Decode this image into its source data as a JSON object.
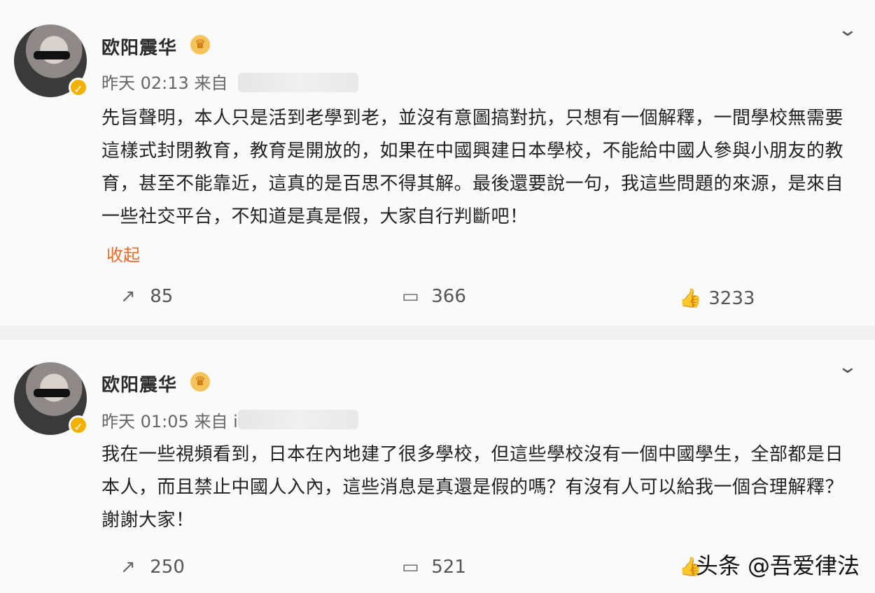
{
  "posts": [
    {
      "author": "欧阳震华",
      "time": "昨天 02:13",
      "source": "来自",
      "content": "先旨聲明，本人只是活到老學到老，並沒有意圖搞對抗，只想有一個解釋，一間學校無需要這樣式封閉教育，教育是開放的，如果在中國興建日本學校，不能給中國人參與小朋友的教育，甚至不能靠近，這真的是百思不得其解。最後還要說一句，我這些問題的來源，是來自一些社交平台，不知道是真是假，大家自行判斷吧！",
      "collapse_label": "收起",
      "reposts": "85",
      "comments": "366",
      "likes": "3233"
    },
    {
      "author": "欧阳震华",
      "time": "昨天 01:05",
      "source": "来自 i",
      "content": "我在一些視頻看到，日本在內地建了很多學校，但這些學校沒有一個中國學生，全部都是日本人，而且禁止中國人入內，這些消息是真還是假的嗎？有沒有人可以給我一個合理解釋？謝謝大家！",
      "reposts": "250",
      "comments": "521"
    }
  ],
  "icons": {
    "repost": "repost-icon",
    "comment": "comment-icon",
    "like": "thumb-up-icon",
    "chevron": "chevron-down-icon",
    "crown": "crown-icon",
    "verified": "verified-icon"
  },
  "watermark": "头条 @吾爱律法",
  "colors": {
    "accent": "#e96b2a",
    "verified": "#f2b100",
    "background": "#f0f0f0",
    "card": "#fafafa"
  }
}
